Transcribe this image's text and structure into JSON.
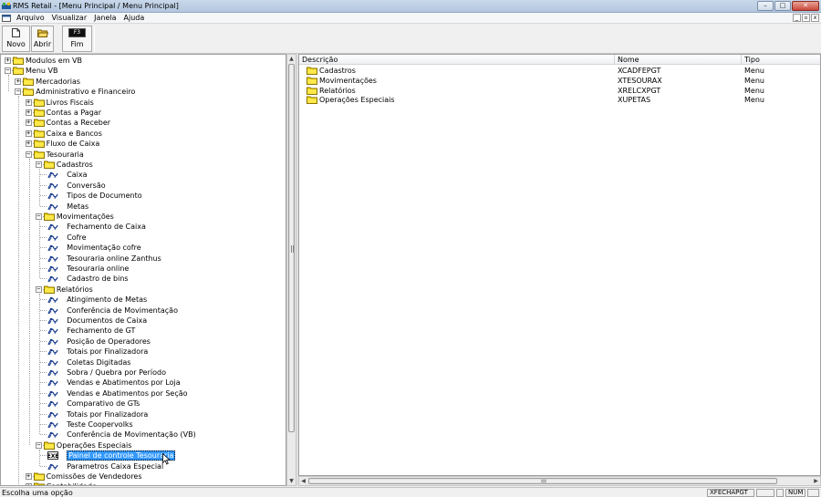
{
  "window": {
    "title": "RMS Retail - [Menu Principal / Menu Principal]",
    "controls": {
      "minimize": "–",
      "maximize": "□",
      "close": "✕"
    }
  },
  "menubar": {
    "items": [
      "Arquivo",
      "Visualizar",
      "Janela",
      "Ajuda"
    ],
    "mdi_controls": {
      "minimize": "_",
      "restore": "▫",
      "close": "x"
    }
  },
  "toolbar": {
    "buttons": [
      {
        "label": "Novo",
        "icon": "new-document-icon"
      },
      {
        "label": "Abrir",
        "icon": "open-folder-icon"
      },
      {
        "label": "Fim",
        "icon": "f3-key-icon",
        "key": "F3"
      }
    ]
  },
  "tree": {
    "items": [
      {
        "label": "Modulos em VB",
        "level": 0,
        "kind": "folder",
        "expander": "+"
      },
      {
        "label": "Menu VB",
        "level": 0,
        "kind": "folder",
        "expander": "-"
      },
      {
        "label": "Mercadorias",
        "level": 1,
        "kind": "folder",
        "expander": "+"
      },
      {
        "label": "Administrativo e Financeiro",
        "level": 1,
        "kind": "folder",
        "expander": "-"
      },
      {
        "label": "Livros Fiscais",
        "level": 2,
        "kind": "folder",
        "expander": "+"
      },
      {
        "label": "Contas a Pagar",
        "level": 2,
        "kind": "folder",
        "expander": "+"
      },
      {
        "label": "Contas a Receber",
        "level": 2,
        "kind": "folder",
        "expander": "+"
      },
      {
        "label": "Caixa e Bancos",
        "level": 2,
        "kind": "folder",
        "expander": "+"
      },
      {
        "label": "Fluxo de Caixa",
        "level": 2,
        "kind": "folder",
        "expander": "+"
      },
      {
        "label": "Tesouraria",
        "level": 2,
        "kind": "folder",
        "expander": "-"
      },
      {
        "label": "Cadastros",
        "level": 3,
        "kind": "folder",
        "expander": "-"
      },
      {
        "label": "Caixa",
        "level": 4,
        "kind": "leaf"
      },
      {
        "label": "Conversão",
        "level": 4,
        "kind": "leaf"
      },
      {
        "label": "Tipos de Documento",
        "level": 4,
        "kind": "leaf"
      },
      {
        "label": "Metas",
        "level": 4,
        "kind": "leaf"
      },
      {
        "label": "Movimentações",
        "level": 3,
        "kind": "folder",
        "expander": "-"
      },
      {
        "label": "Fechamento de Caixa",
        "level": 4,
        "kind": "leaf"
      },
      {
        "label": "Cofre",
        "level": 4,
        "kind": "leaf"
      },
      {
        "label": "Movimentação cofre",
        "level": 4,
        "kind": "leaf"
      },
      {
        "label": "Tesouraria online Zanthus",
        "level": 4,
        "kind": "leaf"
      },
      {
        "label": "Tesouraria online",
        "level": 4,
        "kind": "leaf"
      },
      {
        "label": "Cadastro de bins",
        "level": 4,
        "kind": "leaf"
      },
      {
        "label": "Relatórios",
        "level": 3,
        "kind": "folder",
        "expander": "-"
      },
      {
        "label": "Atingimento de Metas",
        "level": 4,
        "kind": "leaf"
      },
      {
        "label": "Conferência de Movimentação",
        "level": 4,
        "kind": "leaf"
      },
      {
        "label": "Documentos de Caixa",
        "level": 4,
        "kind": "leaf"
      },
      {
        "label": "Fechamento de GT",
        "level": 4,
        "kind": "leaf"
      },
      {
        "label": "Posição de Operadores",
        "level": 4,
        "kind": "leaf"
      },
      {
        "label": "Totais por Finalizadora",
        "level": 4,
        "kind": "leaf"
      },
      {
        "label": "Coletas Digitadas",
        "level": 4,
        "kind": "leaf"
      },
      {
        "label": "Sobra / Quebra por Período",
        "level": 4,
        "kind": "leaf"
      },
      {
        "label": "Vendas e Abatimentos por Loja",
        "level": 4,
        "kind": "leaf"
      },
      {
        "label": "Vendas e Abatimentos por Seção",
        "level": 4,
        "kind": "leaf"
      },
      {
        "label": "Comparativo de GTs",
        "level": 4,
        "kind": "leaf"
      },
      {
        "label": "Totais por Finalizadora",
        "level": 4,
        "kind": "leaf"
      },
      {
        "label": "Teste Coopervolks",
        "level": 4,
        "kind": "leaf"
      },
      {
        "label": "Conferência de Movimentação (VB)",
        "level": 4,
        "kind": "leaf"
      },
      {
        "label": "Operações Especiais",
        "level": 3,
        "kind": "folder",
        "expander": "-"
      },
      {
        "label": "Painel de controle Tesouraria",
        "level": 4,
        "kind": "leaf",
        "icon": "exe-icon",
        "selected": true
      },
      {
        "label": "Parametros Caixa Especial",
        "level": 4,
        "kind": "leaf"
      },
      {
        "label": "Comissões de Vendedores",
        "level": 2,
        "kind": "folder",
        "expander": "+"
      },
      {
        "label": "Contabilidade",
        "level": 2,
        "kind": "folder",
        "expander": "+"
      }
    ]
  },
  "listview": {
    "columns": [
      "Descrição",
      "Nome",
      "Tipo"
    ],
    "rows": [
      {
        "descricao": "Cadastros",
        "nome": "XCADFEPGT",
        "tipo": "Menu"
      },
      {
        "descricao": "Movimentações",
        "nome": "XTESOURAX",
        "tipo": "Menu"
      },
      {
        "descricao": "Relatórios",
        "nome": "XRELCXPGT",
        "tipo": "Menu"
      },
      {
        "descricao": "Operações Especiais",
        "nome": "XUPETAS",
        "tipo": "Menu"
      }
    ]
  },
  "status": {
    "text": "Escolha uma opção",
    "panel_program": "XFECHAPGT",
    "panel_blank1": "",
    "panel_blank2": "",
    "panel_num": "NUM",
    "panel_blank3": ""
  },
  "colors": {
    "selection": "#3399ff",
    "folder": "#f5d600",
    "titlebar": "#c9d8ea"
  }
}
